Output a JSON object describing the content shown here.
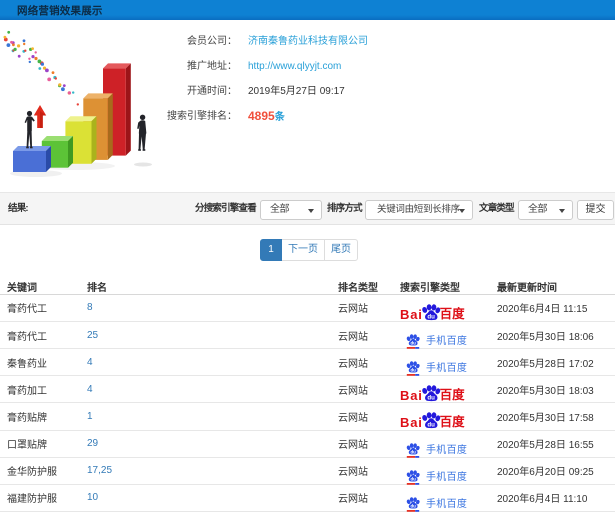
{
  "header": {
    "title": "网络营销效果展示"
  },
  "info": {
    "fields": [
      {
        "label": "会员公司：",
        "value": "济南秦鲁药业科技有限公司",
        "kind": "link"
      },
      {
        "label": "推广地址：",
        "value": "http://www.qlyyjt.com",
        "kind": "link"
      },
      {
        "label": "开通时间：",
        "value": "2019年5月27日 09:17",
        "kind": "text"
      },
      {
        "label": "搜索引擎排名：",
        "value": "4895",
        "suffix": "条",
        "kind": "count"
      }
    ],
    "illustration": "3d-bar-chart-with-businessmen"
  },
  "filters": {
    "result_label": "结果:",
    "engine_label": "分搜索引擎查看",
    "engine_value": "全部",
    "sort_label": "排序方式",
    "sort_value": "关键词由短到长排序",
    "article_label": "文章类型",
    "article_value": "全部",
    "submit_label": "提交"
  },
  "pagination": {
    "current": "1",
    "next": "下一页",
    "last": "尾页"
  },
  "table": {
    "headers": [
      "关键词",
      "排名",
      "排名类型",
      "搜索引擎类型",
      "最新更新时间"
    ],
    "engine_names": {
      "baidu": "Baidu百度",
      "mobile": "手机百度"
    },
    "baidu_logo": {
      "bai": "Bai",
      "du": "百度"
    },
    "mobile_label": "手机百度",
    "rows": [
      {
        "keyword": "膏药代工",
        "rank": "8",
        "rank_type": "云网站",
        "engine": "baidu",
        "time": "2020年6月4日 11:15"
      },
      {
        "keyword": "膏药代工",
        "rank": "25",
        "rank_type": "云网站",
        "engine": "mobile",
        "time": "2020年5月30日 18:06"
      },
      {
        "keyword": "秦鲁药业",
        "rank": "4",
        "rank_type": "云网站",
        "engine": "mobile",
        "time": "2020年5月28日 17:02"
      },
      {
        "keyword": "膏药加工",
        "rank": "4",
        "rank_type": "云网站",
        "engine": "baidu",
        "time": "2020年5月30日 18:03"
      },
      {
        "keyword": "膏药贴牌",
        "rank": "1",
        "rank_type": "云网站",
        "engine": "baidu",
        "time": "2020年5月30日 17:58"
      },
      {
        "keyword": "口罩贴牌",
        "rank": "29",
        "rank_type": "云网站",
        "engine": "mobile",
        "time": "2020年5月28日 16:55"
      },
      {
        "keyword": "金华防护服",
        "rank": "17,25",
        "rank_type": "云网站",
        "engine": "mobile",
        "time": "2020年6月20日 09:25"
      },
      {
        "keyword": "福建防护服",
        "rank": "10",
        "rank_type": "云网站",
        "engine": "mobile",
        "time": "2020年6月4日 11:10"
      }
    ]
  },
  "colors": {
    "header_bg": "#0e81d3",
    "link_blue": "#29a0d8",
    "count_red": "#f0503c",
    "pager_blue": "#337ab7",
    "baidu_red": "#de0f17",
    "baidu_blue": "#2319dc",
    "mobile_blue": "#3c76e0"
  }
}
